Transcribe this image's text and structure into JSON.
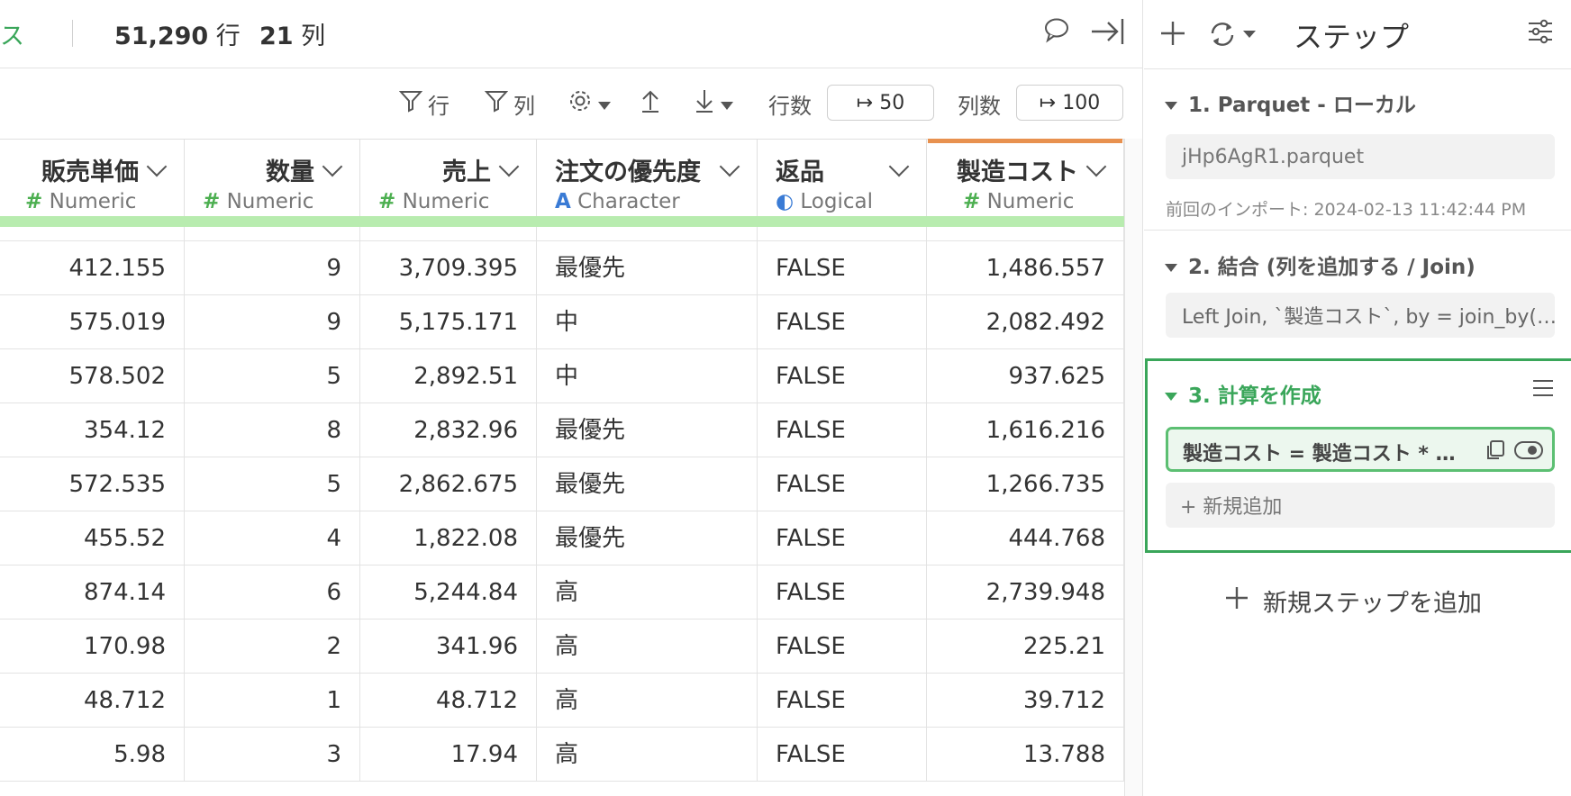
{
  "header": {
    "crumb": "ス",
    "rows_value": "51,290",
    "rows_unit": "行",
    "cols_value": "21",
    "cols_unit": "列"
  },
  "toolbar": {
    "filter_rows_label": "行",
    "filter_cols_label": "列",
    "row_count_label": "行数",
    "row_count_value": "↦ 50",
    "col_count_label": "列数",
    "col_count_value": "↦ 100"
  },
  "table": {
    "columns": [
      {
        "name": "販売単価",
        "type_symbol": "#",
        "type": "Numeric"
      },
      {
        "name": "数量",
        "type_symbol": "#",
        "type": "Numeric"
      },
      {
        "name": "売上",
        "type_symbol": "#",
        "type": "Numeric"
      },
      {
        "name": "注文の優先度",
        "type_symbol": "A",
        "type": "Character"
      },
      {
        "name": "返品",
        "type_symbol": "◐",
        "type": "Logical"
      },
      {
        "name": "製造コスト",
        "type_symbol": "#",
        "type": "Numeric"
      }
    ],
    "rows": [
      [
        "412.155",
        "9",
        "3,709.395",
        "最優先",
        "FALSE",
        "1,486.557"
      ],
      [
        "575.019",
        "9",
        "5,175.171",
        "中",
        "FALSE",
        "2,082.492"
      ],
      [
        "578.502",
        "5",
        "2,892.51",
        "中",
        "FALSE",
        "937.625"
      ],
      [
        "354.12",
        "8",
        "2,832.96",
        "最優先",
        "FALSE",
        "1,616.216"
      ],
      [
        "572.535",
        "5",
        "2,862.675",
        "最優先",
        "FALSE",
        "1,266.735"
      ],
      [
        "455.52",
        "4",
        "1,822.08",
        "最優先",
        "FALSE",
        "444.768"
      ],
      [
        "874.14",
        "6",
        "5,244.84",
        "高",
        "FALSE",
        "2,739.948"
      ],
      [
        "170.98",
        "2",
        "341.96",
        "高",
        "FALSE",
        "225.21"
      ],
      [
        "48.712",
        "1",
        "48.712",
        "高",
        "FALSE",
        "39.712"
      ],
      [
        "5.98",
        "3",
        "17.94",
        "高",
        "FALSE",
        "13.788"
      ]
    ]
  },
  "panel": {
    "title": "ステップ",
    "steps": [
      {
        "title": "1. Parquet - ローカル",
        "value": "jHp6AgR1.parquet",
        "note": "前回のインポート: 2024-02-13 11:42:44 PM"
      },
      {
        "title": "2. 結合 (列を追加する / Join)",
        "value": "Left Join, `製造コスト`, by = join_by(…"
      },
      {
        "title": "3. 計算を作成",
        "value": "製造コスト = 製造コスト * …",
        "add_label": "+ 新規追加"
      }
    ],
    "add_step_label": "新規ステップを追加"
  },
  "colors": {
    "accent_green": "#3aa65a",
    "highlight_bar": "#b8ecaf",
    "orange_marker": "#e8914f"
  }
}
